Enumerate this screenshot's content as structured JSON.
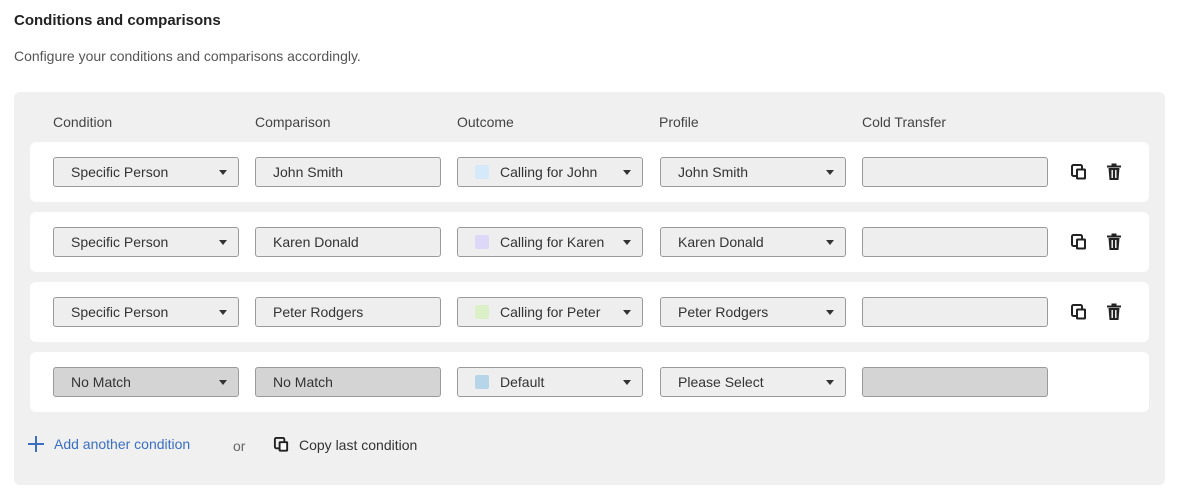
{
  "section": {
    "title": "Conditions and comparisons",
    "subtitle": "Configure your conditions and comparisons accordingly."
  },
  "headers": {
    "condition": "Condition",
    "comparison": "Comparison",
    "outcome": "Outcome",
    "profile": "Profile",
    "cold_transfer": "Cold Transfer"
  },
  "rows": [
    {
      "condition": "Specific Person",
      "comparison": "John Smith",
      "outcome": "Calling for John",
      "outcome_color": "#d6e9fb",
      "profile": "John Smith",
      "cold_transfer": ""
    },
    {
      "condition": "Specific Person",
      "comparison": "Karen Donald",
      "outcome": "Calling for Karen",
      "outcome_color": "#ddd8f8",
      "profile": "Karen Donald",
      "cold_transfer": ""
    },
    {
      "condition": "Specific Person",
      "comparison": "Peter Rodgers",
      "outcome": "Calling for Peter",
      "outcome_color": "#dcf0c8",
      "profile": "Peter Rodgers",
      "cold_transfer": ""
    },
    {
      "condition": "No Match",
      "comparison": "No Match",
      "outcome": "Default",
      "outcome_color": "#b7d5e8",
      "profile": "Please Select",
      "cold_transfer": ""
    }
  ],
  "footer": {
    "add_label": "Add another condition",
    "or_label": "or",
    "copy_label": "Copy last condition"
  },
  "colors": {
    "accent": "#3b6fc4",
    "panel_bg": "#f0f0f0",
    "disabled_bg": "#d4d4d4"
  },
  "icons": {
    "copy": "copy-icon",
    "delete": "trash-icon",
    "add": "plus-icon",
    "dropdown": "chevron-down-icon"
  }
}
